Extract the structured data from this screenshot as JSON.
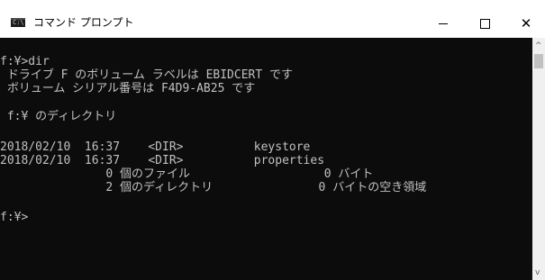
{
  "window": {
    "title": "コマンド プロンプト",
    "icon": "cmd-icon",
    "controls": {
      "minimize": "—",
      "maximize": "□",
      "close": "✕"
    }
  },
  "console": {
    "lines": [
      "f:¥>dir",
      " ドライブ F のボリューム ラベルは EBIDCERT です",
      " ボリューム シリアル番号は F4D9-AB25 です",
      "",
      " f:¥ のディレクトリ",
      "",
      "2018/02/10  16:37    <DIR>          keystore",
      "2018/02/10  16:37    <DIR>          properties",
      "               0 個のファイル                   0 バイト",
      "               2 個のディレクトリ               0 バイトの空き領域",
      "",
      "f:¥>"
    ]
  },
  "colors": {
    "console_bg": "#0c0c0c",
    "console_fg": "#c0c0c0",
    "titlebar_bg": "#ffffff"
  }
}
